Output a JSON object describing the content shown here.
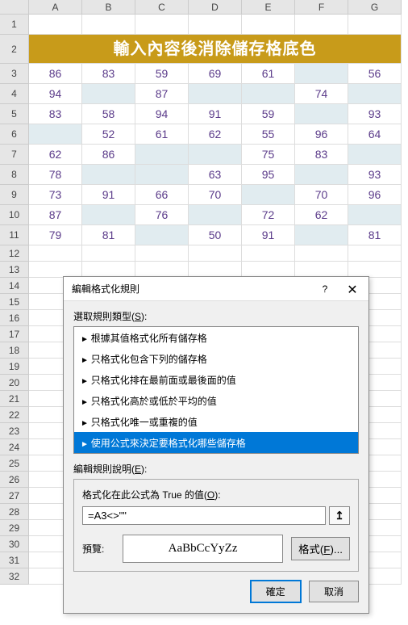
{
  "columns": [
    "A",
    "B",
    "C",
    "D",
    "E",
    "F",
    "G"
  ],
  "title": "輸入內容後消除儲存格底色",
  "grid": [
    [
      "86",
      "83",
      "59",
      "69",
      "61",
      "",
      "56"
    ],
    [
      "94",
      "",
      "87",
      "",
      "",
      "74",
      ""
    ],
    [
      "83",
      "58",
      "94",
      "91",
      "59",
      "",
      "93"
    ],
    [
      "",
      "52",
      "61",
      "62",
      "55",
      "96",
      "64"
    ],
    [
      "62",
      "86",
      "",
      "",
      "75",
      "83",
      ""
    ],
    [
      "78",
      "",
      "",
      "63",
      "95",
      "",
      "93"
    ],
    [
      "73",
      "91",
      "66",
      "70",
      "",
      "70",
      "96"
    ],
    [
      "87",
      "",
      "76",
      "",
      "72",
      "62",
      ""
    ],
    [
      "79",
      "81",
      "",
      "50",
      "91",
      "",
      "81"
    ]
  ],
  "totalRows": 32,
  "dialog": {
    "title": "編輯格式化規則",
    "help": "?",
    "selectLabelPrefix": "選取規則類型(",
    "selectLabelKey": "S",
    "selectLabelSuffix": "):",
    "rules": [
      "根據其值格式化所有儲存格",
      "只格式化包含下列的儲存格",
      "只格式化排在最前面或最後面的值",
      "只格式化高於或低於平均的值",
      "只格式化唯一或重複的值",
      "使用公式來決定要格式化哪些儲存格"
    ],
    "selectedRuleIndex": 5,
    "editLabelPrefix": "編輯規則說明(",
    "editLabelKey": "E",
    "editLabelSuffix": "):",
    "formulaLabelPrefix": "格式化在此公式為 True 的值(",
    "formulaLabelKey": "O",
    "formulaLabelSuffix": "):",
    "formula": "=A3<>\"\"",
    "refBtn": "↥",
    "previewLabel": "預覽:",
    "previewText": "AaBbCcYyZz",
    "formatBtnPrefix": "格式(",
    "formatBtnKey": "F",
    "formatBtnSuffix": ")...",
    "ok": "確定",
    "cancel": "取消"
  }
}
